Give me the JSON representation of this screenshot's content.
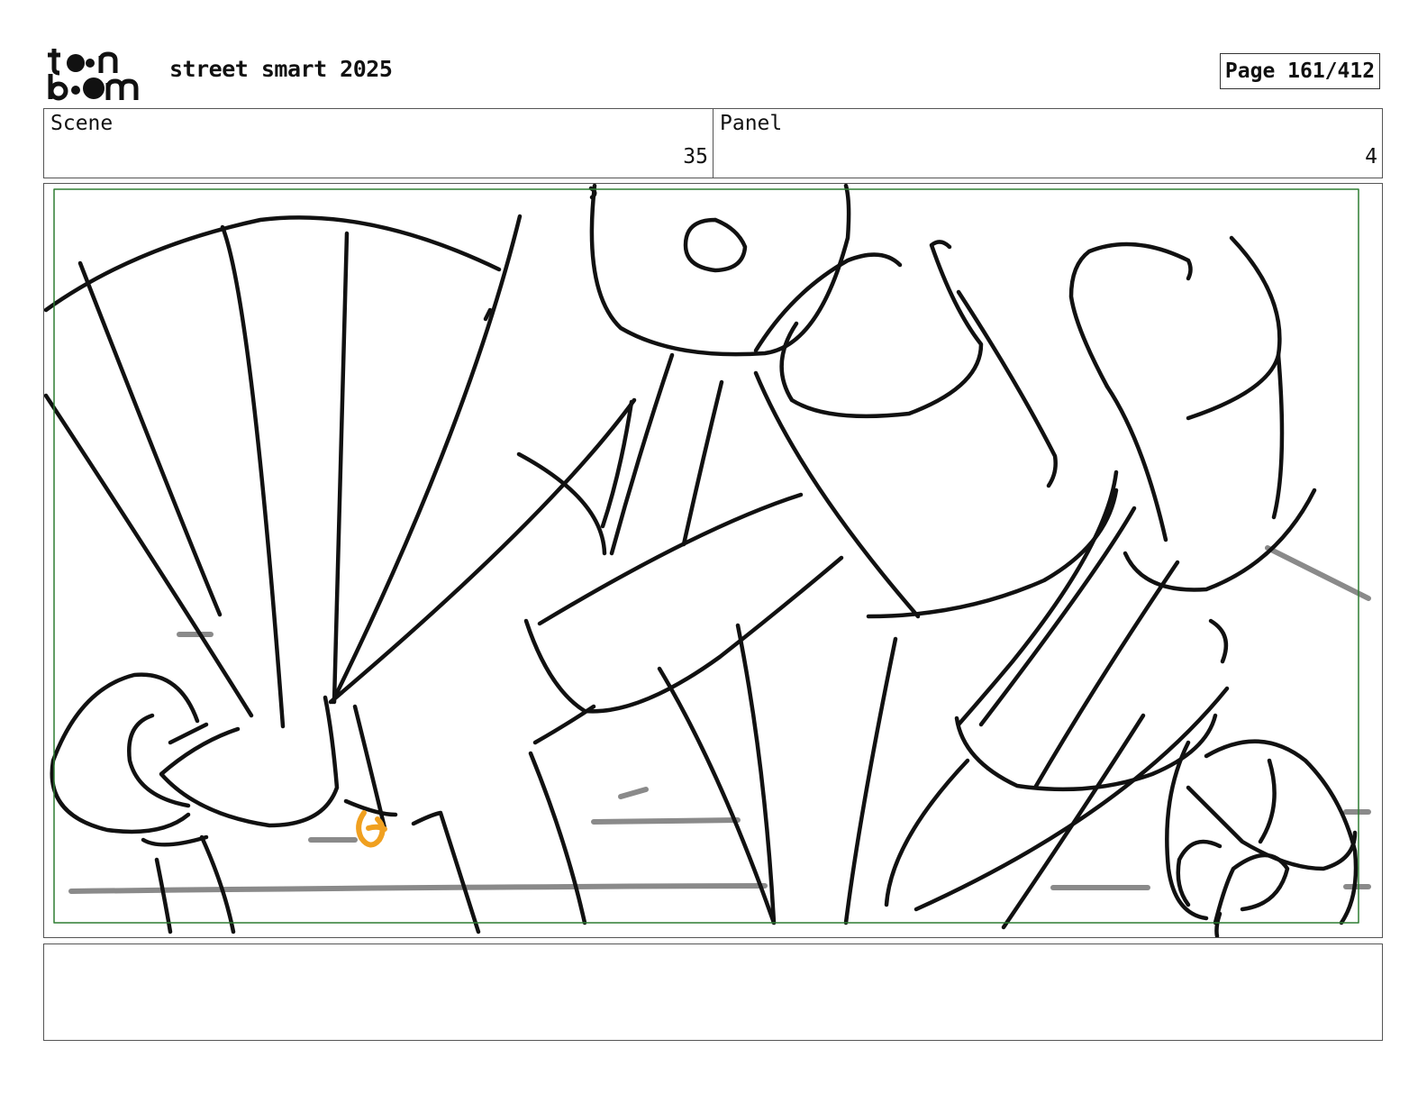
{
  "header": {
    "logo_text": "toonboom",
    "project_title": "street smart 2025",
    "page_label": "Page 161/412"
  },
  "info": {
    "scene_label": "Scene",
    "scene_number": "35",
    "panel_label": "Panel",
    "panel_number": "4"
  },
  "panel": {
    "safe_frame_color": "#2e7d32",
    "line_color": "#111111",
    "shadow_color": "#8a8a8a",
    "accent_color": "#f0a020"
  },
  "notes": {
    "text": ""
  }
}
